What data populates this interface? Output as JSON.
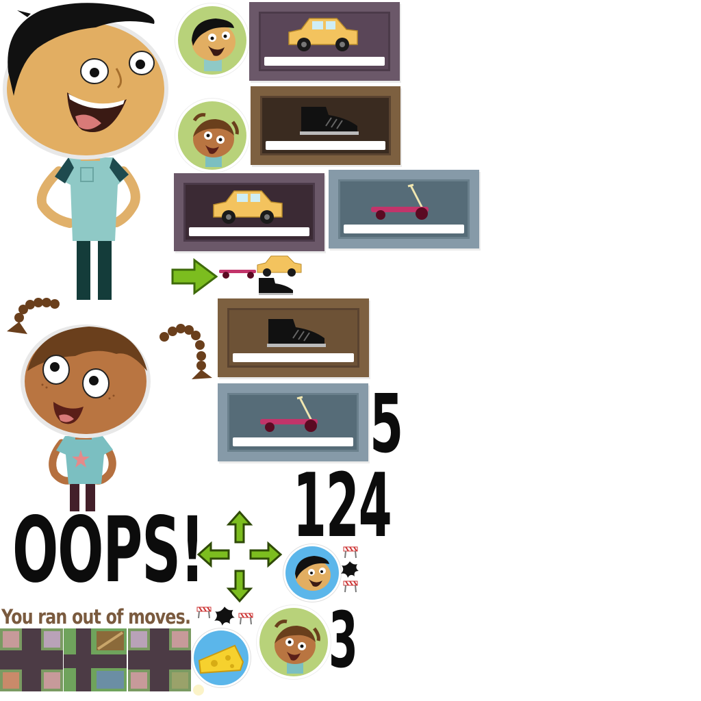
{
  "texts": {
    "oops": "OOPS!",
    "ran_out": "You ran out of moves.",
    "count_a": "5",
    "count_b": "124",
    "count_c": "3"
  },
  "colors": {
    "card_purple": "#5e4a5c",
    "card_brown": "#6b4f31",
    "card_blue": "#869aa8",
    "arrow_green": "#7cbd1f",
    "bubble_green": "#b8d27a",
    "bubble_blue": "#5bb6ea",
    "ran_out_text": "#7a5a3e",
    "number_black": "#0c0c0c"
  },
  "icons": {
    "boy": "boy-character",
    "girl": "girl-character",
    "car": "taxi-car-icon",
    "shoe": "sneaker-icon",
    "scooter": "scooter-icon",
    "cheese": "cheese-icon",
    "barrier": "road-barrier-icon",
    "splat": "ink-splat-icon",
    "arrow": "green-arrow-icon"
  }
}
